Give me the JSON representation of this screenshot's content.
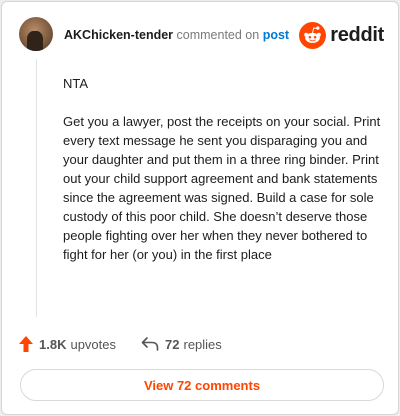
{
  "comment": {
    "username": "AKChicken-tender",
    "action_text": "commented on",
    "post_link": "post",
    "paragraphs": [
      "NTA",
      "Get you a lawyer, post the receipts on your social. Print every text message he sent you disparaging you and your daughter and put them in a three ring binder. Print out your child support agreement and bank statements since the agreement was signed. Build a case for sole custody of this poor child. She doesn’t deserve those people fighting over her when they never bothered to fight for her (or you) in the first place"
    ]
  },
  "brand": {
    "name": "reddit",
    "icon": "reddit-snoo-icon",
    "accent_color": "#ff4500"
  },
  "stats": {
    "upvote_count": "1.8K",
    "upvote_label": "upvotes",
    "upvote_icon": "upvote-arrow-icon",
    "reply_count": "72",
    "reply_label": "replies",
    "reply_icon": "reply-arrow-icon"
  },
  "view_button": {
    "label": "View 72 comments"
  }
}
